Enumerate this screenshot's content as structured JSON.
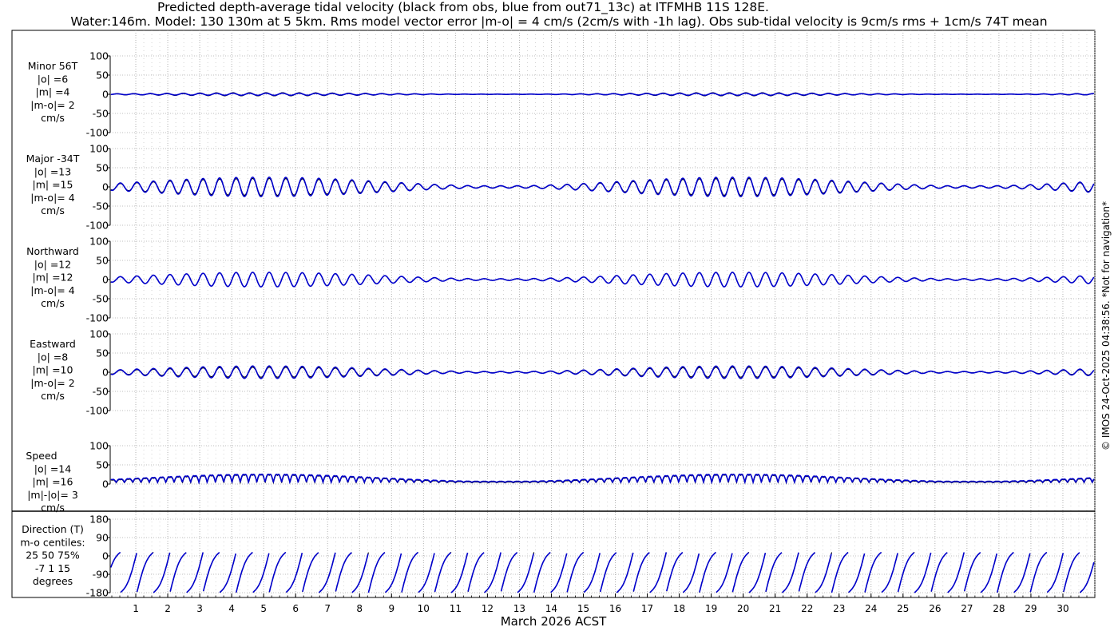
{
  "title_line1": "Predicted depth-average tidal velocity (black from obs, blue from out71_13c) at ITFMHB 11S 128E.",
  "title_line2": "Water:146m. Model: 130 130m at 5 5km. Rms model vector error |m-o| = 4 cm/s (2cm/s with -1h lag). Obs sub-tidal velocity is 9cm/s rms + 1cm/s 74T mean",
  "xlabel": "March 2026 ACST",
  "copyright": "© IMOS 24-Oct-2025 04:38:56. *Not for navigation*",
  "colors": {
    "obs": "#000000",
    "model": "#0000cc",
    "grid": "#999999"
  },
  "chart_data": [
    {
      "type": "line",
      "key": "minor",
      "label": [
        "Minor 56T",
        "|o| =6",
        "|m| =4",
        "|m-o|= 2",
        "cm/s"
      ],
      "ylim": [
        -100,
        100
      ],
      "yticks": [
        100,
        50,
        0,
        -50,
        -100
      ],
      "ytick_labels": [
        "100",
        "50",
        "0",
        "-50",
        "-100"
      ],
      "xlim": [
        0.2,
        31
      ],
      "x_ticks": [
        1,
        2,
        3,
        4,
        5,
        6,
        7,
        8,
        9,
        10,
        11,
        12,
        13,
        14,
        15,
        16,
        17,
        18,
        19,
        20,
        21,
        22,
        23,
        24,
        25,
        26,
        27,
        28,
        29,
        30
      ],
      "series": [
        {
          "name": "obs",
          "rms": 6
        },
        {
          "name": "model",
          "rms": 4
        }
      ],
      "amp": 7
    },
    {
      "type": "line",
      "key": "major",
      "label": [
        "Major -34T",
        "|o| =13",
        "|m| =15",
        "|m-o|= 4",
        "cm/s"
      ],
      "ylim": [
        -100,
        100
      ],
      "yticks": [
        100,
        50,
        0,
        -50,
        -100
      ],
      "ytick_labels": [
        "100",
        "50",
        "0",
        "-50",
        "-100"
      ],
      "xlim": [
        0.2,
        31
      ],
      "series": [
        {
          "name": "obs",
          "rms": 13
        },
        {
          "name": "model",
          "rms": 15
        }
      ],
      "amp": 22
    },
    {
      "type": "line",
      "key": "north",
      "label": [
        "Northward",
        "|o| =12",
        "|m| =12",
        "|m-o|= 4",
        "cm/s"
      ],
      "ylim": [
        -100,
        100
      ],
      "yticks": [
        100,
        50,
        0,
        -50,
        -100
      ],
      "ytick_labels": [
        "100",
        "50",
        "0",
        "-50",
        "-100"
      ],
      "xlim": [
        0.2,
        31
      ],
      "series": [
        {
          "name": "obs",
          "rms": 12
        },
        {
          "name": "model",
          "rms": 12
        }
      ],
      "amp": 19
    },
    {
      "type": "line",
      "key": "east",
      "label": [
        "Eastward",
        "|o| =8",
        "|m| =10",
        "|m-o|= 2",
        "cm/s"
      ],
      "ylim": [
        -100,
        100
      ],
      "yticks": [
        100,
        50,
        0,
        -50,
        -100
      ],
      "ytick_labels": [
        "100",
        "50",
        "0",
        "-50",
        "-100"
      ],
      "xlim": [
        0.2,
        31
      ],
      "series": [
        {
          "name": "obs",
          "rms": 8
        },
        {
          "name": "model",
          "rms": 10
        }
      ],
      "amp": 13
    },
    {
      "type": "line",
      "key": "speed",
      "label": [
        "Speed",
        "|o| =14",
        "|m| =16",
        "|m|-|o|= 3",
        "cm/s"
      ],
      "ylim": [
        0,
        100
      ],
      "yticks": [
        100,
        50,
        0
      ],
      "ytick_labels": [
        "100",
        "50",
        "0"
      ],
      "xlim": [
        0.2,
        31
      ],
      "series": [
        {
          "name": "obs",
          "rms": 14
        },
        {
          "name": "model",
          "rms": 16
        }
      ],
      "amp": 24
    },
    {
      "type": "line",
      "key": "dir",
      "label": [
        "Direction (T)",
        "m-o centiles:",
        "25  50  75%",
        "-7   1  15",
        "degrees"
      ],
      "ylim": [
        -180,
        180
      ],
      "yticks": [
        180,
        90,
        0,
        -90,
        -180
      ],
      "ytick_labels": [
        "180",
        "90",
        "0",
        "-90",
        "-180"
      ],
      "xlim": [
        0.2,
        31
      ],
      "series": [
        {
          "name": "obs"
        },
        {
          "name": "model"
        }
      ]
    }
  ]
}
